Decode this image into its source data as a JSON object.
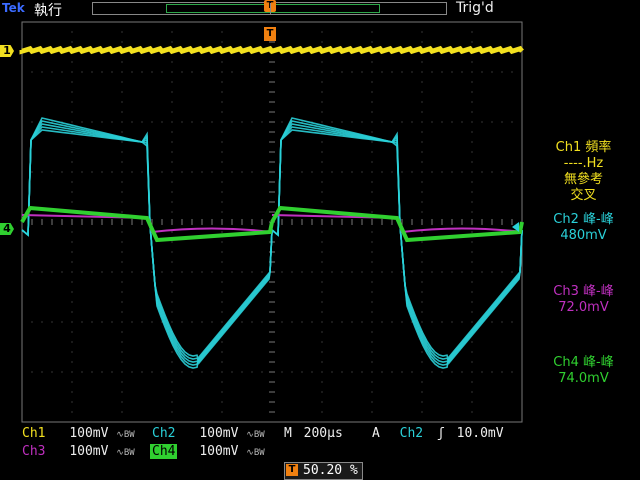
{
  "header": {
    "logo": "Tek",
    "run_state": "執行",
    "trigger_status": "Trig'd",
    "trigger_icon": "T"
  },
  "markers": {
    "ch1": "1",
    "ch4": "4",
    "trigger_position": "T"
  },
  "colors": {
    "ch1": "#f2e020",
    "ch2": "#2ad0d8",
    "ch3": "#c030c0",
    "ch4": "#30d030",
    "accent": "#f08010",
    "grid": "#555555"
  },
  "measurements": [
    {
      "title": "Ch1 頻率",
      "lines": [
        "----.Hz",
        "無參考",
        "交叉"
      ],
      "color": "#f2e020"
    },
    {
      "title": "Ch2 峰-峰",
      "lines": [
        "480mV"
      ],
      "color": "#2ad0d8"
    },
    {
      "title": "Ch3 峰-峰",
      "lines": [
        "72.0mV"
      ],
      "color": "#c030c0"
    },
    {
      "title": "Ch4 峰-峰",
      "lines": [
        "74.0mV"
      ],
      "color": "#30d030"
    }
  ],
  "readouts": {
    "ch1": {
      "label": "Ch1",
      "scale": "100mV",
      "coupling": "∿BW"
    },
    "ch2": {
      "label": "Ch2",
      "scale": "100mV",
      "coupling": "∿BW"
    },
    "ch3": {
      "label": "Ch3",
      "scale": "100mV",
      "coupling": "∿BW"
    },
    "ch4": {
      "label": "Ch4",
      "scale": "100mV",
      "coupling": "∿BW"
    },
    "timebase": {
      "label": "M",
      "value": "200µs"
    },
    "trigger": {
      "mode": "A",
      "source": "Ch2",
      "slope": "ʃ",
      "level": "10.0mV"
    },
    "trigger_position": {
      "icon": "T",
      "value": "50.20 %"
    }
  },
  "waveforms": {
    "period_divisions": 5.0,
    "note_units": "divisions"
  }
}
